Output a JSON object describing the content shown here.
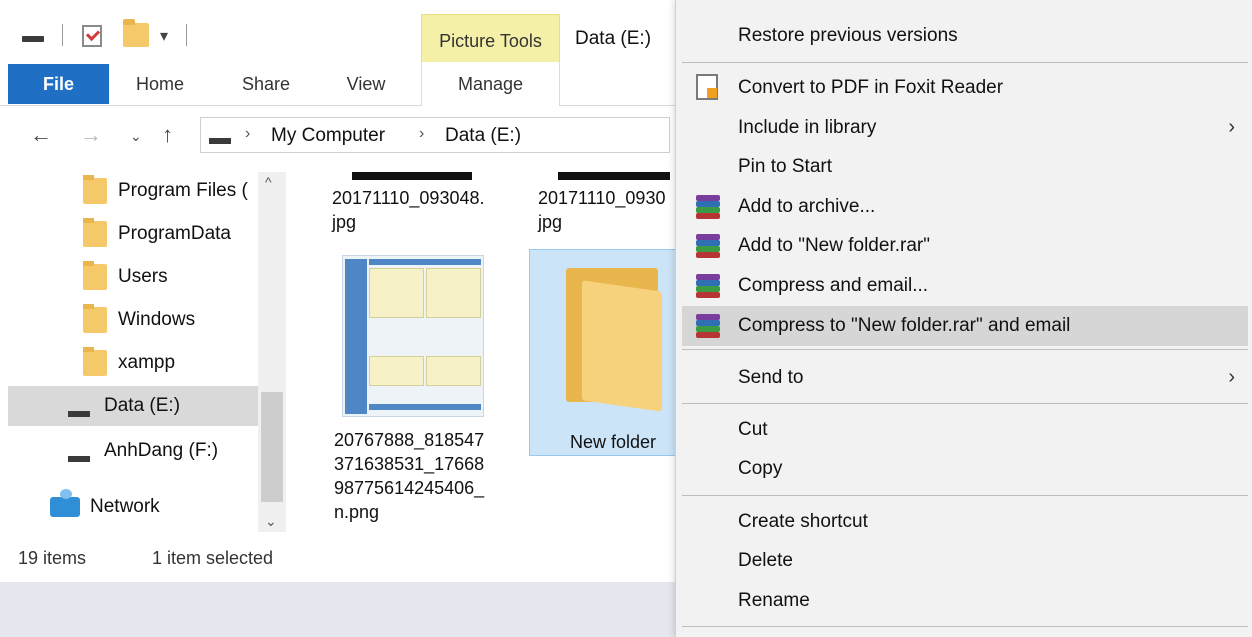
{
  "explorer": {
    "ribbon": {
      "tools_tab": "Picture Tools",
      "window_title": "Data (E:)",
      "tabs": [
        "File",
        "Home",
        "Share",
        "View",
        "Manage"
      ]
    },
    "address": {
      "crumbs": [
        "My Computer",
        "Data (E:)"
      ]
    },
    "nav": {
      "folders": [
        "Program Files (",
        "ProgramData",
        "Users",
        "Windows",
        "xampp"
      ],
      "drives": [
        "Data (E:)",
        "AnhDang (F:)"
      ],
      "network": "Network"
    },
    "files": [
      {
        "name": "20171110_093048.\njpg"
      },
      {
        "name": "20171110_0930\njpg"
      },
      {
        "name": "20767888_818547\n371638531_17668\n98775614245406_\nn.png"
      },
      {
        "name": "New folder"
      }
    ],
    "status": {
      "count": "19 items",
      "selected": "1 item selected"
    }
  },
  "context_menu": {
    "items": [
      {
        "label": "Restore previous versions"
      },
      {
        "label": "Convert to PDF in Foxit Reader",
        "icon": "foxit-pdf-icon"
      },
      {
        "label": "Include in library",
        "submenu": true
      },
      {
        "label": "Pin to Start"
      },
      {
        "label": "Add to archive...",
        "icon": "winrar-icon"
      },
      {
        "label": "Add to \"New folder.rar\"",
        "icon": "winrar-icon"
      },
      {
        "label": "Compress and email...",
        "icon": "winrar-icon"
      },
      {
        "label": "Compress to \"New folder.rar\" and email",
        "icon": "winrar-icon",
        "hovered": true
      },
      {
        "label": "Send to",
        "submenu": true
      },
      {
        "label": "Cut"
      },
      {
        "label": "Copy"
      },
      {
        "label": "Create shortcut"
      },
      {
        "label": "Delete"
      },
      {
        "label": "Rename"
      }
    ]
  },
  "colors": {
    "file_tab": "#1f6fc5",
    "picture_tools": "#f4f0a8",
    "selection": "#cce4f7",
    "menu_bg": "#f2f2f2",
    "menu_hover": "#d6d6d6"
  }
}
